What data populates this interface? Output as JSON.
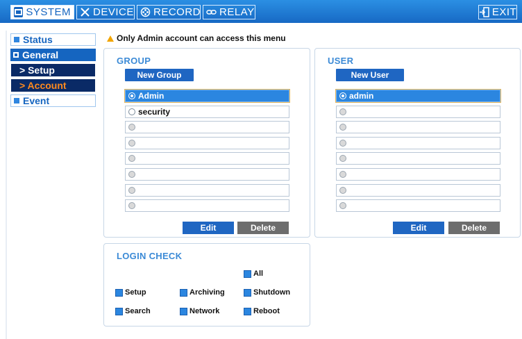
{
  "topbar": {
    "tabs": [
      {
        "label": "SYSTEM",
        "icon": "monitor-icon",
        "active": true
      },
      {
        "label": "DEVICE",
        "icon": "tools-icon",
        "active": false
      },
      {
        "label": "RECORD",
        "icon": "film-reel-icon",
        "active": false
      },
      {
        "label": "RELAY",
        "icon": "link-icon",
        "active": false
      }
    ],
    "exit_label": "EXIT",
    "exit_icon": "exit-icon"
  },
  "sidebar": {
    "items": [
      {
        "label": "Status"
      },
      {
        "label": "General"
      },
      {
        "label": "> Setup"
      },
      {
        "label": "> Account"
      },
      {
        "label": "Event"
      }
    ]
  },
  "notice": "Only Admin account can access this menu",
  "group": {
    "title": "GROUP",
    "new_label": "New Group",
    "rows": [
      "Admin",
      "security",
      "",
      "",
      "",
      "",
      "",
      ""
    ],
    "edit_label": "Edit",
    "delete_label": "Delete"
  },
  "user": {
    "title": "USER",
    "new_label": "New User",
    "rows": [
      "admin",
      "",
      "",
      "",
      "",
      "",
      "",
      ""
    ],
    "edit_label": "Edit",
    "delete_label": "Delete"
  },
  "login_check": {
    "title": "LOGIN CHECK",
    "items": [
      "All",
      "Setup",
      "Archiving",
      "Shutdown",
      "Search",
      "Network",
      "Reboot"
    ]
  },
  "colors": {
    "accent": "#1f66c2",
    "topbar": "#1f78d6",
    "selected_row": "#2b86e0",
    "account_text": "#ff8a1e",
    "delete_button": "#6d6d6d"
  }
}
